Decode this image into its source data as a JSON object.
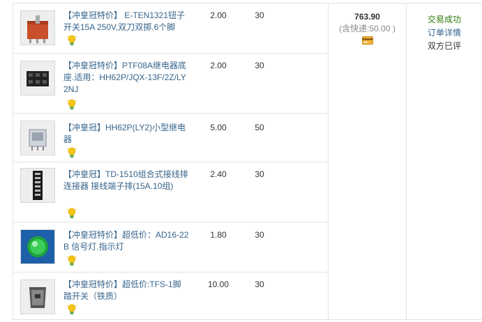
{
  "items": [
    {
      "title": "【冲皇冠特价】 E-TEN1321钮子开关15A 250V,双刀双掷.6个脚",
      "price": "2.00",
      "qty": "30",
      "thumb_icon": "toggle-switch-icon",
      "badge_icon": "bulb-icon"
    },
    {
      "title": "【冲皇冠特价】PTF08A继电器底座.适用：HH62P/JQX-13F/2Z/LY2NJ",
      "price": "2.00",
      "qty": "30",
      "thumb_icon": "relay-socket-icon",
      "badge_icon": "bulb-icon"
    },
    {
      "title": "【冲皇冠】HH62P(LY2)小型继电器",
      "price": "5.00",
      "qty": "50",
      "thumb_icon": "relay-icon",
      "badge_icon": "bulb-icon"
    },
    {
      "title": "【冲皇冠】TD-1510组合式接线排 连接器 接线端子排(15A.10组)",
      "price": "2.40",
      "qty": "30",
      "thumb_icon": "terminal-block-icon",
      "badge_icon": "bulb-icon"
    },
    {
      "title": "【冲皇冠特价】超低价：AD16-22B 信号灯.指示灯",
      "price": "1.80",
      "qty": "30",
      "thumb_icon": "indicator-light-icon",
      "badge_icon": "bulb-icon"
    },
    {
      "title": "【冲皇冠特价】超低价:TFS-1脚踏开关（铁质）",
      "price": "10.00",
      "qty": "30",
      "thumb_icon": "foot-switch-icon",
      "badge_icon": "bulb-icon"
    }
  ],
  "order": {
    "total": "763.90",
    "shipping": "(含快递:50.00 )",
    "payment_icon": "card-icon"
  },
  "status": {
    "state": "交易成功",
    "details_link": "订单详情",
    "review": "双方已评"
  },
  "colors": {
    "link": "#36648b",
    "success": "#2e7d0c",
    "border": "#e3e3e3"
  }
}
